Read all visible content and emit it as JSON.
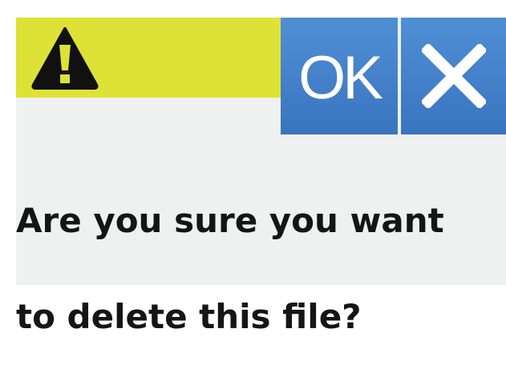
{
  "dialog": {
    "icon": "warning-icon",
    "ok_label": "OK",
    "close_icon": "close-icon",
    "message_line1": "Are you sure you want",
    "message_line2": "to delete this file?"
  },
  "colors": {
    "warning_bar": "#dfe236",
    "button_blue": "#4682cb",
    "background": "#eef1ef",
    "text": "#151515"
  }
}
